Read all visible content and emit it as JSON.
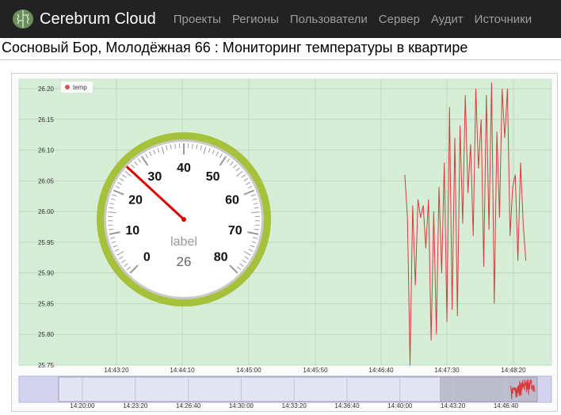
{
  "app": {
    "brand": "Cerebrum Cloud",
    "nav": [
      "Проекты",
      "Регионы",
      "Пользователи",
      "Сервер",
      "Аудит",
      "Источники"
    ]
  },
  "page": {
    "title": "Сосновый Бор, Молодёжная 66 : Мониторинг температуры в квартире"
  },
  "colors": {
    "navbar": "#222222",
    "plot_bg": "#d6eed7",
    "series": "#d93b3b",
    "navigator_bg": "#d3d3ee",
    "gauge_rim": "#a6c13a",
    "needle": "#dd0000"
  },
  "gauge": {
    "label": "label",
    "value": 26,
    "min": 0,
    "max": 80,
    "numbers": [
      "0",
      "10",
      "20",
      "30",
      "40",
      "50",
      "60",
      "70",
      "80"
    ]
  },
  "chart_data": {
    "type": "line",
    "series": [
      {
        "name": "temp",
        "x": [
          "14:46:58",
          "14:47:00",
          "14:47:02",
          "14:47:04",
          "14:47:06",
          "14:47:08",
          "14:47:10",
          "14:47:12",
          "14:47:14",
          "14:47:16",
          "14:47:18",
          "14:47:20",
          "14:47:22",
          "14:47:24",
          "14:47:26",
          "14:47:28",
          "14:47:30",
          "14:47:32",
          "14:47:34",
          "14:47:36",
          "14:47:38",
          "14:47:40",
          "14:47:42",
          "14:47:44",
          "14:47:46",
          "14:47:48",
          "14:47:50",
          "14:47:52",
          "14:47:54",
          "14:47:56",
          "14:47:58",
          "14:48:00",
          "14:48:02",
          "14:48:04",
          "14:48:06",
          "14:48:08",
          "14:48:10",
          "14:48:12",
          "14:48:14",
          "14:48:16",
          "14:48:18",
          "14:48:20",
          "14:48:22",
          "14:48:24",
          "14:48:26",
          "14:48:28",
          "14:48:30"
        ],
        "values": [
          26.06,
          25.99,
          25.75,
          26.01,
          25.88,
          26.02,
          25.99,
          26.01,
          25.94,
          26.02,
          25.79,
          26.0,
          25.8,
          26.04,
          25.9,
          26.08,
          25.82,
          26.17,
          25.84,
          26.12,
          25.83,
          26.14,
          25.98,
          26.19,
          26.03,
          26.11,
          25.96,
          26.2,
          26.07,
          26.15,
          25.91,
          26.19,
          25.97,
          26.21,
          25.85,
          26.13,
          25.99,
          26.2,
          26.12,
          26.2,
          25.96,
          26.04,
          26.06,
          25.92,
          26.08,
          25.98,
          25.92
        ]
      }
    ],
    "xlabel": "",
    "ylabel": "",
    "x_ticks": [
      "14:43:20",
      "14:44:10",
      "14:45:00",
      "14:45:50",
      "14:46:40",
      "14:47:30",
      "14:48:20"
    ],
    "y_ticks": [
      "26.20",
      "26.15",
      "26.10",
      "26.05",
      "26.00",
      "25.95",
      "25.90",
      "25.85",
      "25.80",
      "25.75"
    ],
    "ylim": [
      25.75,
      26.21
    ],
    "legend": "top-left",
    "grid": true,
    "navigator_ticks": [
      "14:20:00",
      "14:23:20",
      "14:26:40",
      "14:30:00",
      "14:33:20",
      "14:36:40",
      "14:40:00",
      "14:43:20",
      "14:46:40"
    ]
  }
}
